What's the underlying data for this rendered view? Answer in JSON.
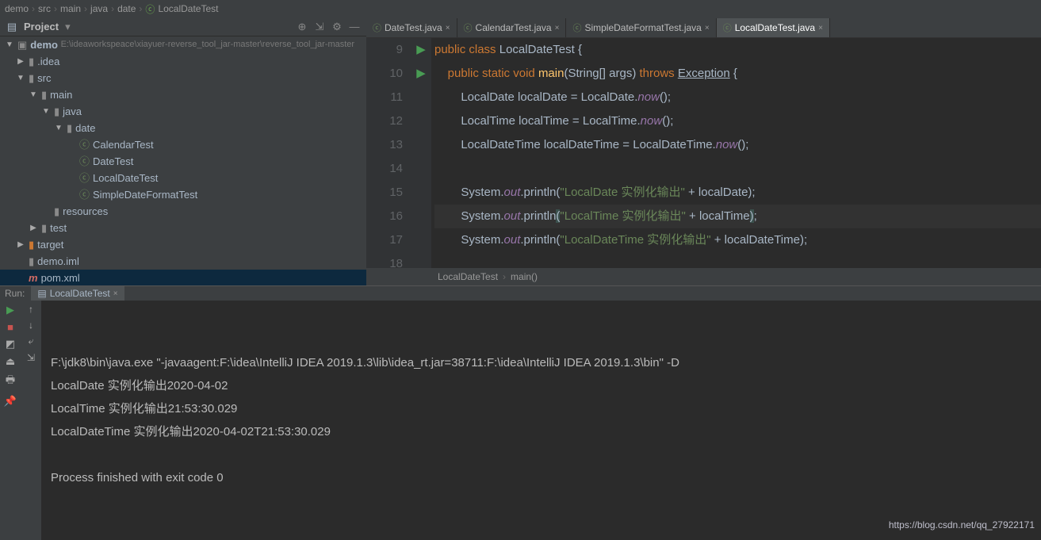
{
  "breadcrumb": {
    "items": [
      "demo",
      "src",
      "main",
      "java",
      "date",
      "LocalDateTest"
    ]
  },
  "projectTool": {
    "title": "Project"
  },
  "tree": {
    "root": {
      "name": "demo",
      "path": "E:\\ideaworkspeace\\xiayuer-reverse_tool_jar-master\\reverse_tool_jar-master"
    },
    "idea": ".idea",
    "src": "src",
    "main": "main",
    "java": "java",
    "date": "date",
    "files": [
      "CalendarTest",
      "DateTest",
      "LocalDateTest",
      "SimpleDateFormatTest"
    ],
    "resources": "resources",
    "test": "test",
    "target": "target",
    "demoIml": "demo.iml",
    "pom": "pom.xml"
  },
  "tabs": [
    {
      "label": "DateTest.java",
      "active": false
    },
    {
      "label": "CalendarTest.java",
      "active": false
    },
    {
      "label": "SimpleDateFormatTest.java",
      "active": false
    },
    {
      "label": "LocalDateTest.java",
      "active": true
    }
  ],
  "code": {
    "start": 9,
    "lines": [
      {
        "n": 9,
        "run": true,
        "html": "<span class='k'>public</span> <span class='k'>class</span> <span class='t'>LocalDateTest</span> {"
      },
      {
        "n": 10,
        "run": true,
        "html": "    <span class='k'>public</span> <span class='k'>static</span> <span class='k'>void</span> <span class='m'>main</span>(String[] args) <span class='k'>throws</span> <span class='underline'>Exception</span> {"
      },
      {
        "n": 11,
        "html": "        LocalDate localDate = LocalDate.<span class='f'>now</span>();"
      },
      {
        "n": 12,
        "html": "        LocalTime localTime = LocalTime.<span class='f'>now</span>();"
      },
      {
        "n": 13,
        "html": "        LocalDateTime localDateTime = LocalDateTime.<span class='f'>now</span>();"
      },
      {
        "n": 14,
        "html": ""
      },
      {
        "n": 15,
        "html": "        System.<span class='f'>out</span>.println(<span class='s'>\"LocalDate 实例化输出\"</span> + localDate);"
      },
      {
        "n": 16,
        "hl": true,
        "html": "        System.<span class='f'>out</span>.println<span class='paren'>(</span><span class='s'>\"LocalTime 实例化输出\"</span> + localTime<span class='paren'>)</span>;"
      },
      {
        "n": 17,
        "html": "        System.<span class='f'>out</span>.println(<span class='s'>\"LocalDateTime 实例化输出\"</span> + localDateTime);"
      },
      {
        "n": 18,
        "html": ""
      }
    ]
  },
  "editorCrumb": {
    "class": "LocalDateTest",
    "method": "main()"
  },
  "run": {
    "label": "Run:",
    "tab": "LocalDateTest",
    "lines": [
      "F:\\jdk8\\bin\\java.exe \"-javaagent:F:\\idea\\IntelliJ IDEA 2019.1.3\\lib\\idea_rt.jar=38711:F:\\idea\\IntelliJ IDEA 2019.1.3\\bin\" -D",
      "LocalDate 实例化输出2020-04-02",
      "LocalTime 实例化输出21:53:30.029",
      "LocalDateTime 实例化输出2020-04-02T21:53:30.029",
      "",
      "Process finished with exit code 0"
    ]
  },
  "watermark": "https://blog.csdn.net/qq_27922171"
}
